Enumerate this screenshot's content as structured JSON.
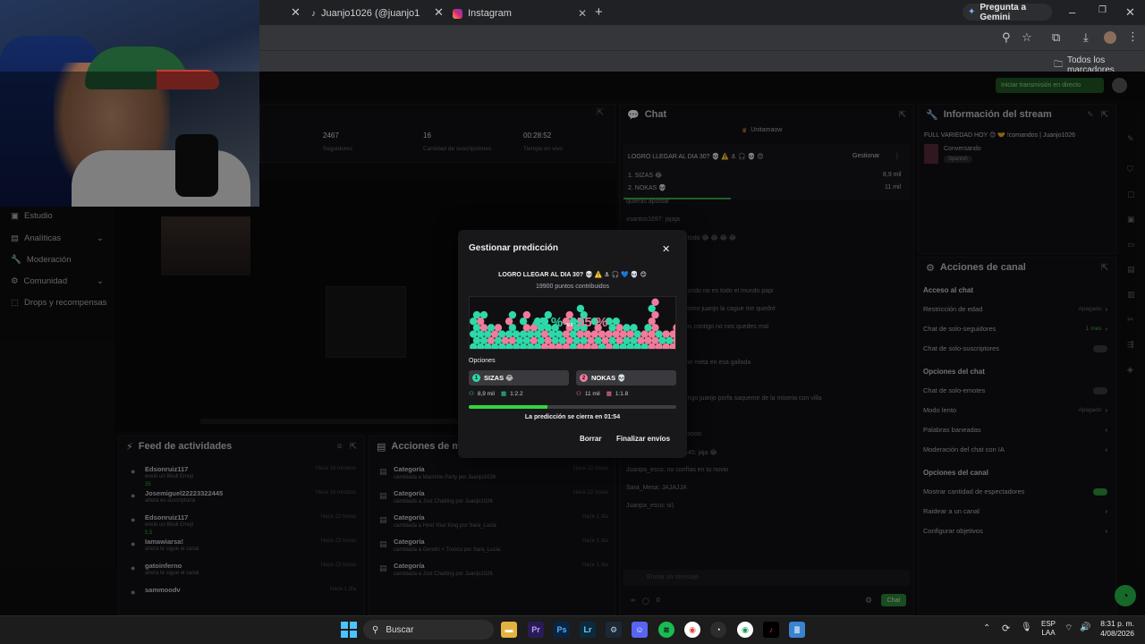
{
  "browser": {
    "tabs": [
      {
        "label": "Juanjo1026 (@juanjo1026_) | Ti"
      },
      {
        "label": "Instagram"
      }
    ],
    "gemini_label": "Pregunta a Gemini",
    "bookmarks_label": "Todos los marcadores"
  },
  "dashboard": {
    "live_badge": "Iniciar transmisión en directo",
    "stats": [
      {
        "value": "2467",
        "label": "Seguidores"
      },
      {
        "value": "16",
        "label": "Cantidad de suscripciones"
      },
      {
        "value": "00:28:52",
        "label": "Tiempo en vivo"
      }
    ],
    "sidebar": [
      {
        "label": "Estudio"
      },
      {
        "label": "Analíticas"
      },
      {
        "label": "Moderación"
      },
      {
        "label": "Comunidad"
      },
      {
        "label": "Drops y recompensas"
      }
    ],
    "feed": {
      "title": "Feed de actividades",
      "items": [
        {
          "name": "Edsonruiz117",
          "detail": "envió un Bkull Emoji",
          "time": "Hace 16 minutos",
          "extra": "35"
        },
        {
          "name": "Josemiguel22223322445",
          "detail": "ahora es suscriptor/a",
          "time": "Hace 18 minutos"
        },
        {
          "name": "Edsonruiz117",
          "detail": "envió un Bkull Emoji",
          "time": "Hace 22 horas",
          "extra": "5.5"
        },
        {
          "name": "Iamawiarsa!",
          "detail": "ahora te sigue el canal",
          "time": "Hace 23 horas"
        },
        {
          "name": "gatoinferno",
          "detail": "ahora te sigue el canal",
          "time": "Hace 23 horas"
        },
        {
          "name": "sammoodv",
          "detail": "",
          "time": "Hace 1 día"
        }
      ]
    },
    "mod_actions": {
      "title": "Acciones de mod",
      "items": [
        {
          "label": "Categoría",
          "detail": "cambiada a Machine Party por Juanjo1026",
          "time": "Hace 22 horas"
        },
        {
          "label": "Categoría",
          "detail": "cambiada a Just Chatting por Juanjo1026",
          "time": "Hace 22 horas"
        },
        {
          "label": "Categoría",
          "detail": "cambiada a Hold Your King por Sara_Lucia",
          "time": "Hace 1 día"
        },
        {
          "label": "Categoría",
          "detail": "cambiada a Genshi + Tronco por Sara_Lucia",
          "time": "Hace 1 día"
        },
        {
          "label": "Categoría",
          "detail": "cambiada a Just Chatting por Juanjo1026",
          "time": "Hace 1 día"
        }
      ]
    },
    "chat": {
      "title": "Chat",
      "pinned_user": "Unitamaow",
      "prediction_title": "LOGRO LLEGAR AL DIA 30? 💀 ⚠️ ⚓ 🎧 💀 😊",
      "manage_label": "Gestionar",
      "prediction_options": [
        {
          "label": "1. SIZAS 😂",
          "value": "8,9 mil"
        },
        {
          "label": "2. NOKAS 💀",
          "value": "11 mil"
        }
      ],
      "messages": [
        "quieras apostar",
        "xsantos1697: jajaja",
        "Ummmu: hpta apostè todo 😂 😂 😂 😂",
        "Sara_Mesa:",
        "g327:",
        "Sara_Mesa: todo el mundo no es todo el mundo papi",
        "aposté 1000 puntos, como juanjo la cague me quedré",
        "juanjo muchos estamos contigo no nos quedes mal",
        "g327: Veo dia 30?",
        "Sara_Mesa: a mi no me meta en esa gallada",
        "g327: No que 35??",
        "aposte los puntos q tengo juanjo porfa saqueme de la miseria con villa",
        "g327: Alo?",
        "edsonruiz117: se murioooo",
        "Jmanolgsd22223322445: jaja 😂",
        "Juanpa_esco: no confías en tu novio",
        "Sara_Mesa: JAJAJJA",
        "Juanpa_esco: si)"
      ],
      "input_placeholder": "Enviar un mensaje",
      "points": "0",
      "viewers": "0",
      "send_label": "Chat"
    },
    "stream_info": {
      "title": "Información del stream",
      "stream_title": "FULL VARIEDAD HOY 😊 🤝 !comandos | Juanjo1026",
      "category": "Conversando",
      "language": "Spanish"
    },
    "channel_actions": {
      "title": "Acciones de canal",
      "sections": [
        {
          "heading": "Acceso al chat",
          "rows": [
            {
              "label": "Restricción de edad",
              "value": "Apagado"
            },
            {
              "label": "Chat de solo-seguidores",
              "value": "1 mes"
            },
            {
              "label": "Chat de solo-suscriptores",
              "value": ""
            }
          ]
        },
        {
          "heading": "Opciones del chat",
          "rows": [
            {
              "label": "Chat de solo-emotes",
              "value": ""
            },
            {
              "label": "Modo lento",
              "value": "Apagado"
            },
            {
              "label": "Palabras baneadas",
              "value": ""
            },
            {
              "label": "Moderación del chat con IA",
              "value": ""
            }
          ]
        },
        {
          "heading": "Opciones del canal",
          "rows": [
            {
              "label": "Mostrar cantidad de espectadores",
              "value": ""
            },
            {
              "label": "Raidear a un canal",
              "value": ""
            },
            {
              "label": "Configurar objetivos",
              "value": ""
            }
          ]
        }
      ]
    }
  },
  "modal": {
    "title": "Gestionar predicción",
    "question": "LOGRO LLEGAR AL DIA 30? 💀 ⚠️ ⚓ 🎧 💙 💀 😊",
    "points": "19900 puntos contribuidos",
    "percent_a": "45 %",
    "vs": "vs",
    "percent_b": "55 %",
    "share_a": 0.45,
    "options_label": "Opciones",
    "options": [
      {
        "letter": "1",
        "label": "SIZAS 😂",
        "points": "8,9 mil",
        "ratio": "1:2.2",
        "color": "#2fd8a8"
      },
      {
        "letter": "2",
        "label": "NOKAS 💀",
        "points": "11 mil",
        "ratio": "1:1.8",
        "color": "#f07b9b"
      }
    ],
    "progress": 0.38,
    "timer_text": "La predicción se cierra en 01:54",
    "cancel_label": "Borrar",
    "confirm_label": "Finalizar envíos"
  },
  "taskbar": {
    "search_placeholder": "Buscar",
    "lang_top": "ESP",
    "lang_bottom": "LAA",
    "time": "8:31 p. m.",
    "date": "4/08/2026"
  }
}
